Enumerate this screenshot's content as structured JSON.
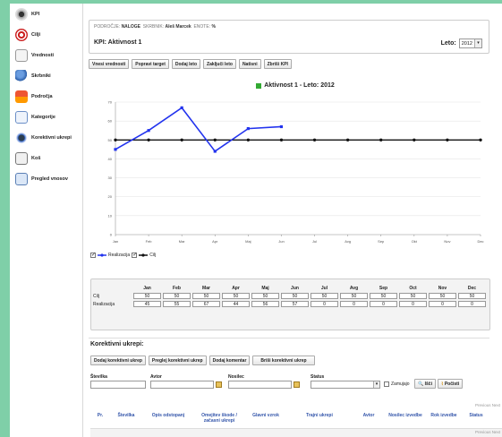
{
  "sidebar": {
    "items": [
      {
        "label": "KPI",
        "icon": "kpi-icon"
      },
      {
        "label": "Cilji",
        "icon": "target-icon"
      },
      {
        "label": "Vrednosti",
        "icon": "values-icon"
      },
      {
        "label": "Skrbniki",
        "icon": "users-icon"
      },
      {
        "label": "Področja",
        "icon": "areas-icon"
      },
      {
        "label": "Kategorije",
        "icon": "categories-icon"
      },
      {
        "label": "Korektivni ukrepi",
        "icon": "corrective-icon"
      },
      {
        "label": "Koš",
        "icon": "trash-icon"
      },
      {
        "label": "Pregled vnosov",
        "icon": "entries-icon"
      }
    ]
  },
  "header": {
    "breadcrumb": [
      {
        "key": "PODROČJE:",
        "value": "NALOGE"
      },
      {
        "key": "SKRBNIK:",
        "value": "Aleš Marcek"
      },
      {
        "key": "ENOTE:",
        "value": "%"
      }
    ],
    "kpi_title": "KPI: Aktivnost 1",
    "leto_label": "Leto:",
    "leto_value": "2012"
  },
  "toolbar": {
    "buttons": [
      "Vnesi vrednosti",
      "Popravi target",
      "Dodaj leto",
      "Zaključi leto",
      "Natisni",
      "Zbriši KPI"
    ]
  },
  "chart_data": {
    "type": "line",
    "title": "Aktivnost 1  - Leto: 2012",
    "categories": [
      "Jan",
      "Feb",
      "Mar",
      "Apr",
      "Maj",
      "Jun",
      "Jul",
      "Avg",
      "Sep",
      "Okt",
      "Nov",
      "Dec"
    ],
    "ylim": [
      0,
      70
    ],
    "yticks": [
      0,
      10,
      20,
      30,
      40,
      50,
      60,
      70
    ],
    "grid": true,
    "legend_position": "bottom-left",
    "series": [
      {
        "name": "Realizacija",
        "color": "#2233ee",
        "values": [
          45,
          55,
          67,
          44,
          56,
          57,
          null,
          null,
          null,
          null,
          null,
          null
        ]
      },
      {
        "name": "Cilj",
        "color": "#111111",
        "values": [
          50,
          50,
          50,
          50,
          50,
          50,
          50,
          50,
          50,
          50,
          50,
          50
        ]
      }
    ]
  },
  "legend": {
    "realizacija": "Realizacija",
    "cilj": "Cilj"
  },
  "data_table": {
    "months": [
      "Jan",
      "Feb",
      "Mar",
      "Apr",
      "Maj",
      "Jun",
      "Jul",
      "Avg",
      "Sep",
      "Oct",
      "Nov",
      "Dec"
    ],
    "rows": [
      {
        "label": "Cilj",
        "values": [
          "50",
          "50",
          "50",
          "50",
          "50",
          "50",
          "50",
          "50",
          "50",
          "50",
          "50",
          "50"
        ]
      },
      {
        "label": "Realizacija",
        "values": [
          "45",
          "55",
          "67",
          "44",
          "56",
          "57",
          "0",
          "0",
          "0",
          "0",
          "0",
          "0"
        ]
      }
    ]
  },
  "corrective": {
    "title": "Korektivni ukrepi:",
    "buttons": [
      "Dodaj korektivni ukrep",
      "Preglej korektivni ukrep",
      "Dodaj komentar",
      "Briši korektivni ukrep"
    ],
    "filters": {
      "stevilka_label": "Številka",
      "avtor_label": "Avtor",
      "nosilec_label": "Nosilec",
      "status_label": "Status",
      "zamujajo_label": "Zamujajo",
      "search_label": "Išči",
      "reset_label": "Počisti"
    },
    "pager": "Previous  Next",
    "columns": [
      "Pr.",
      "Številka",
      "Opis odstopanj",
      "Omejitev škode / začasni ukrepi",
      "Glavni vzrok",
      "Trajni ukrepi",
      "Avtor",
      "Nosilec izvedbe",
      "Rok izvedbe",
      "Status"
    ]
  }
}
